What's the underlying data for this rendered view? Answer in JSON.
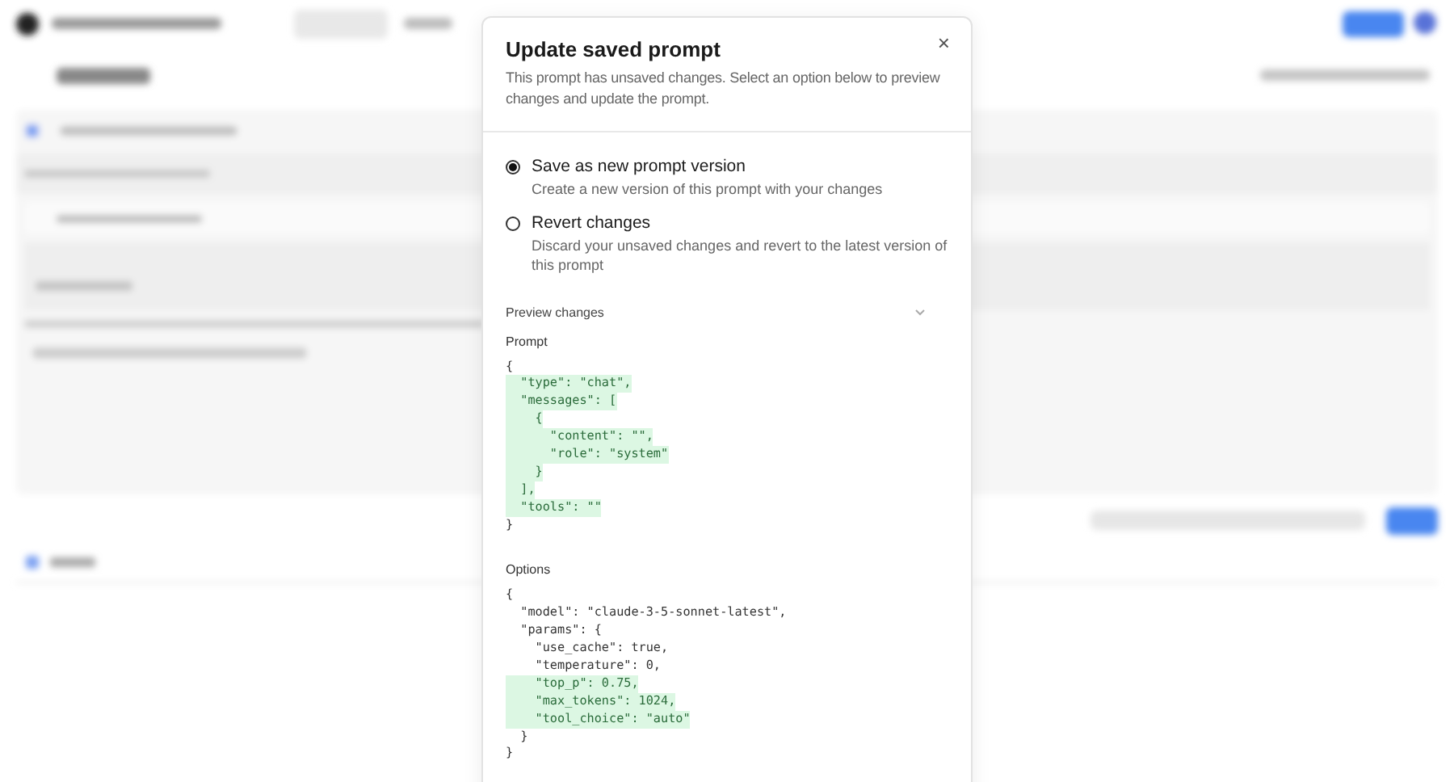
{
  "dialog": {
    "title": "Update saved prompt",
    "close": "×",
    "description": "This prompt has unsaved changes. Select an option below to preview changes and update the prompt.",
    "options": [
      {
        "label": "Save as new prompt version",
        "description": "Create a new version of this prompt with your changes",
        "selected": true
      },
      {
        "label": "Revert changes",
        "description": "Discard your unsaved changes and revert to the latest version of this prompt",
        "selected": false
      }
    ],
    "preview": {
      "label": "Preview changes",
      "expanded": true,
      "sections": [
        {
          "title": "Prompt",
          "lines": [
            {
              "text": "{",
              "added": false
            },
            {
              "text": "  \"type\": \"chat\",",
              "added": true
            },
            {
              "text": "  \"messages\": [",
              "added": true
            },
            {
              "text": "    {",
              "added": true
            },
            {
              "text": "      \"content\": \"\",",
              "added": true
            },
            {
              "text": "      \"role\": \"system\"",
              "added": true
            },
            {
              "text": "    }",
              "added": true
            },
            {
              "text": "  ],",
              "added": true
            },
            {
              "text": "  \"tools\": \"\"",
              "added": true
            },
            {
              "text": "}",
              "added": false
            }
          ]
        },
        {
          "title": "Options",
          "lines": [
            {
              "text": "{",
              "added": false
            },
            {
              "text": "  \"model\": \"claude-3-5-sonnet-latest\",",
              "added": false
            },
            {
              "text": "  \"params\": {",
              "added": false
            },
            {
              "text": "    \"use_cache\": true,",
              "added": false
            },
            {
              "text": "    \"temperature\": 0,",
              "added": false
            },
            {
              "text": "    \"top_p\": 0.75,",
              "added": true
            },
            {
              "text": "    \"max_tokens\": 1024,",
              "added": true
            },
            {
              "text": "    \"tool_choice\": \"auto\"",
              "added": true
            },
            {
              "text": "  }",
              "added": false
            },
            {
              "text": "}",
              "added": false
            }
          ]
        }
      ]
    }
  }
}
